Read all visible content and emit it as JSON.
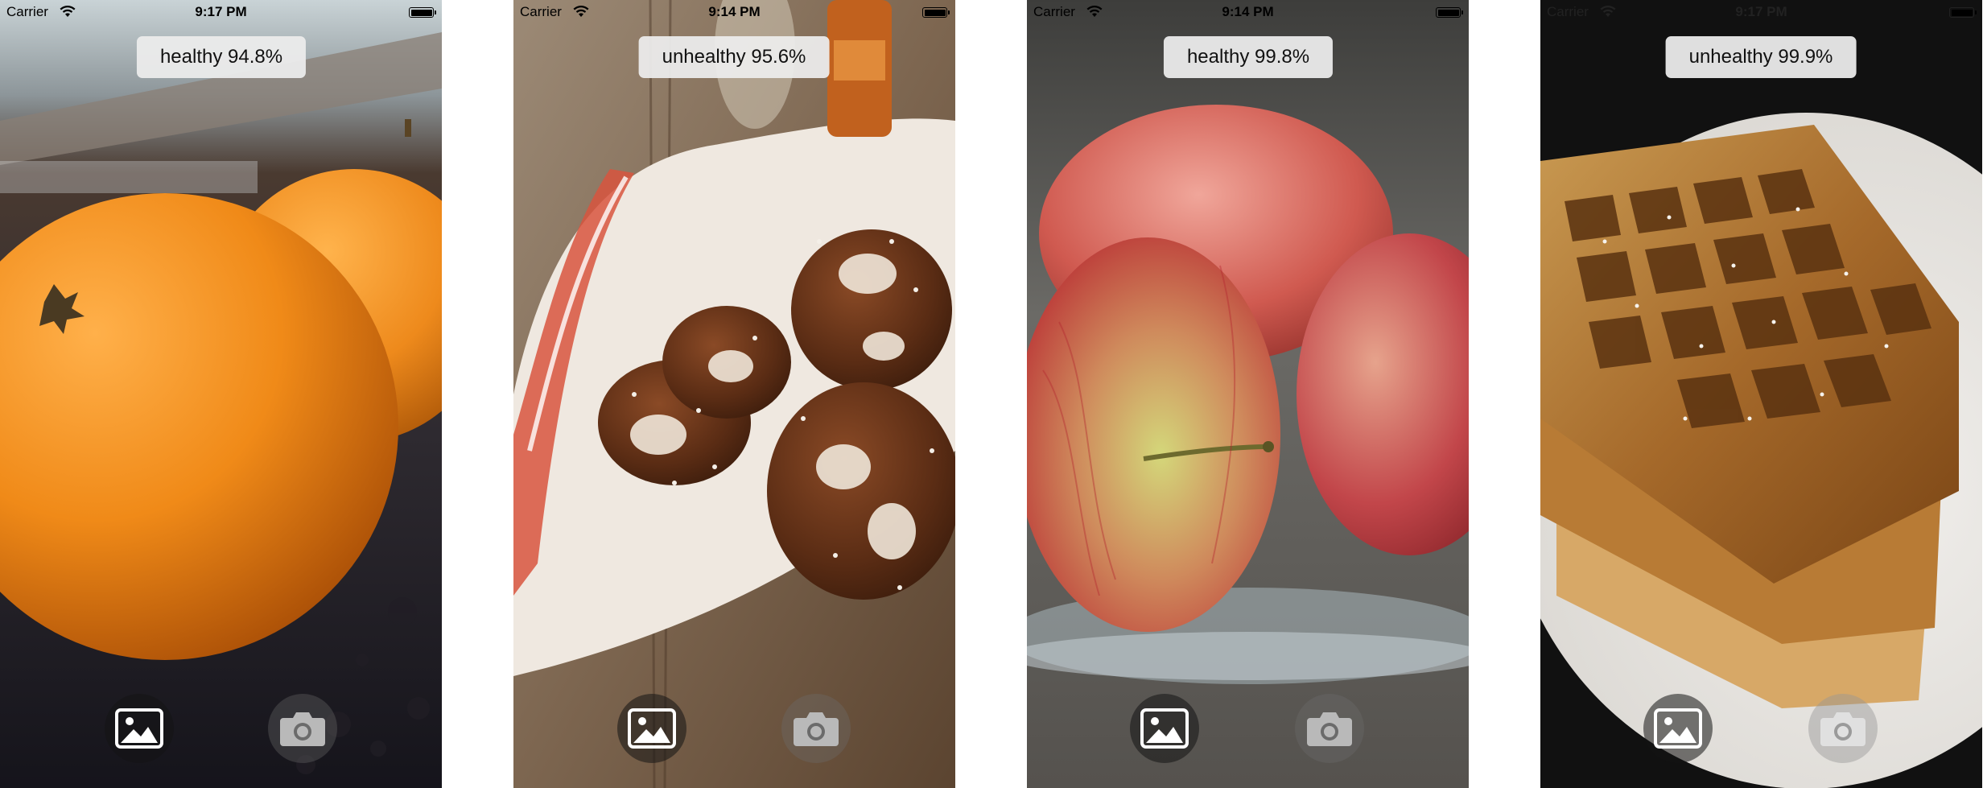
{
  "screens": [
    {
      "id": "oranges",
      "status": {
        "carrier": "Carrier",
        "time": "9:17 PM"
      },
      "result": "healthy 94.8%",
      "photo_subject": "oranges",
      "buttons": {
        "photos_icon": "photo-library-icon",
        "camera_icon": "camera-icon"
      }
    },
    {
      "id": "pretzels",
      "status": {
        "carrier": "Carrier",
        "time": "9:14 PM"
      },
      "result": "unhealthy 95.6%",
      "photo_subject": "pretzels",
      "buttons": {
        "photos_icon": "photo-library-icon",
        "camera_icon": "camera-icon"
      }
    },
    {
      "id": "apples",
      "status": {
        "carrier": "Carrier",
        "time": "9:14 PM"
      },
      "result": "healthy 99.8%",
      "photo_subject": "apples",
      "buttons": {
        "photos_icon": "photo-library-icon",
        "camera_icon": "camera-icon"
      }
    },
    {
      "id": "waffles",
      "status": {
        "carrier": "Carrier",
        "time": "9:17 PM"
      },
      "result": "unhealthy 99.9%",
      "photo_subject": "waffles",
      "buttons": {
        "photos_icon": "photo-library-icon",
        "camera_icon": "camera-icon"
      }
    }
  ],
  "colors": {
    "pill_background": "#ececec",
    "pill_text": "#111111",
    "button_dark": "#333333",
    "icon_white": "#ffffff"
  }
}
